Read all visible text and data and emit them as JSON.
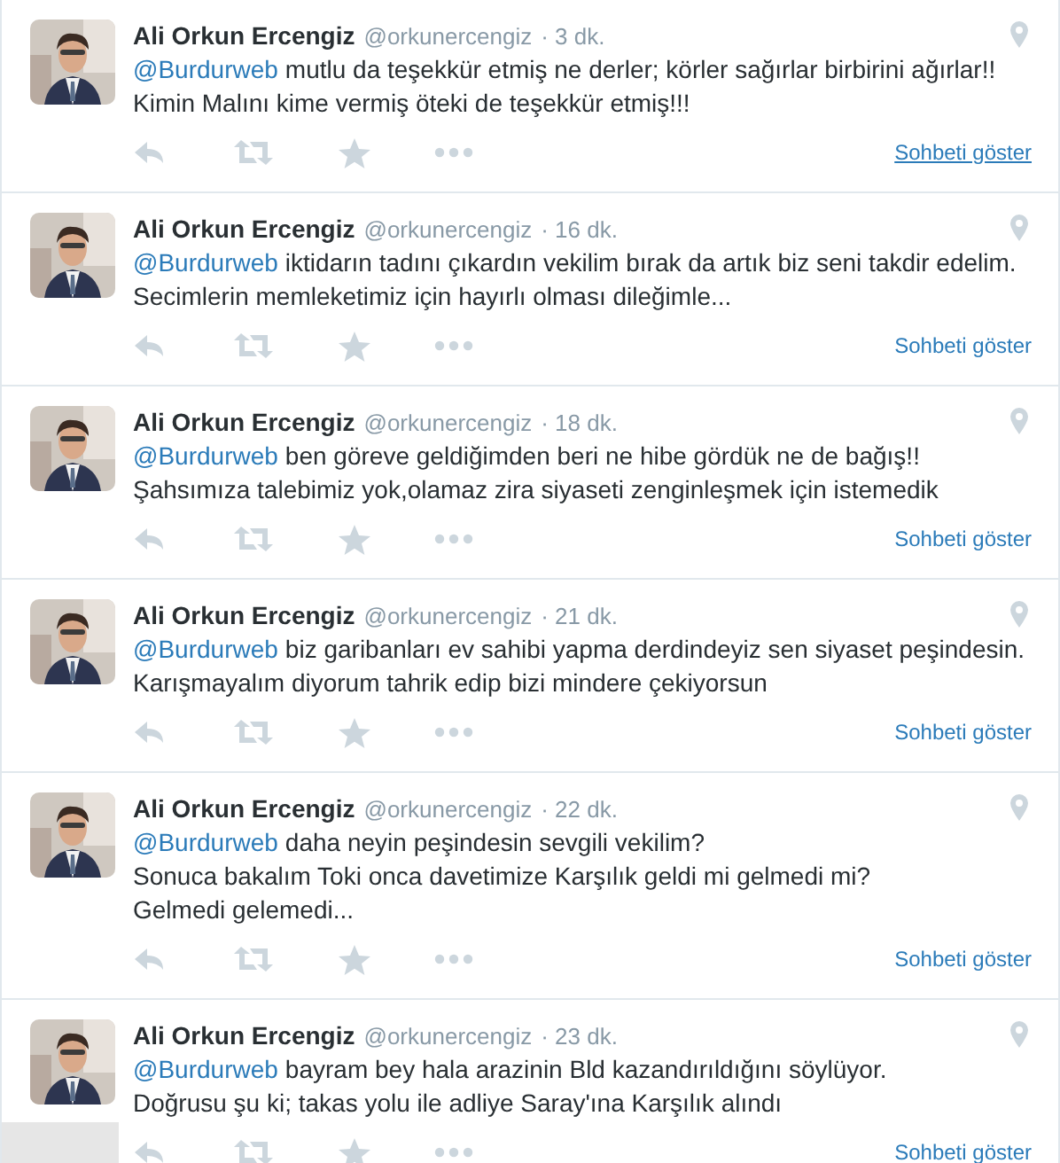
{
  "tweets": [
    {
      "name": "Ali Orkun Ercengiz",
      "handle": "@orkunercengiz",
      "time": "· 3 dk.",
      "mention": "@Burdurweb",
      "lines": [
        "mutlu da teşekkür etmiş ne derler; körler sağırlar birbirini ağırlar!!",
        "Kimin Malını kime vermiş öteki de teşekkür etmiş!!!"
      ],
      "link": "Sohbeti göster",
      "link_underlined": true
    },
    {
      "name": "Ali Orkun Ercengiz",
      "handle": "@orkunercengiz",
      "time": "· 16 dk.",
      "mention": "@Burdurweb",
      "lines": [
        "iktidarın tadını çıkardın vekilim bırak da artık biz seni takdir edelim.",
        "Secimlerin memleketimiz için hayırlı olması dileğimle..."
      ],
      "link": "Sohbeti göster",
      "link_underlined": false
    },
    {
      "name": "Ali Orkun Ercengiz",
      "handle": "@orkunercengiz",
      "time": "· 18 dk.",
      "mention": "@Burdurweb",
      "lines": [
        "ben göreve geldiğimden beri ne hibe gördük ne de bağış!!",
        "Şahsımıza talebimiz yok,olamaz zira siyaseti zenginleşmek için istemedik"
      ],
      "link": "Sohbeti göster",
      "link_underlined": false
    },
    {
      "name": "Ali Orkun Ercengiz",
      "handle": "@orkunercengiz",
      "time": "· 21 dk.",
      "mention": "@Burdurweb",
      "lines": [
        "biz garibanları ev sahibi yapma derdindeyiz sen siyaset peşindesin.",
        "Karışmayalım diyorum tahrik edip bizi mindere çekiyorsun"
      ],
      "link": "Sohbeti göster",
      "link_underlined": false
    },
    {
      "name": "Ali Orkun Ercengiz",
      "handle": "@orkunercengiz",
      "time": "· 22 dk.",
      "mention": "@Burdurweb",
      "lines": [
        "daha neyin peşindesin sevgili vekilim?",
        "Sonuca bakalım Toki onca davetimize Karşılık geldi mi gelmedi mi?",
        "Gelmedi gelemedi..."
      ],
      "link": "Sohbeti göster",
      "link_underlined": false
    },
    {
      "name": "Ali Orkun Ercengiz",
      "handle": "@orkunercengiz",
      "time": "· 23 dk.",
      "mention": "@Burdurweb",
      "lines": [
        "bayram bey hala arazinin Bld kazandırıldığını söylüyor.",
        "Doğrusu şu ki; takas yolu ile adliye Saray'ına Karşılık alındı"
      ],
      "link": "Sohbeti göster",
      "link_underlined": false
    }
  ]
}
